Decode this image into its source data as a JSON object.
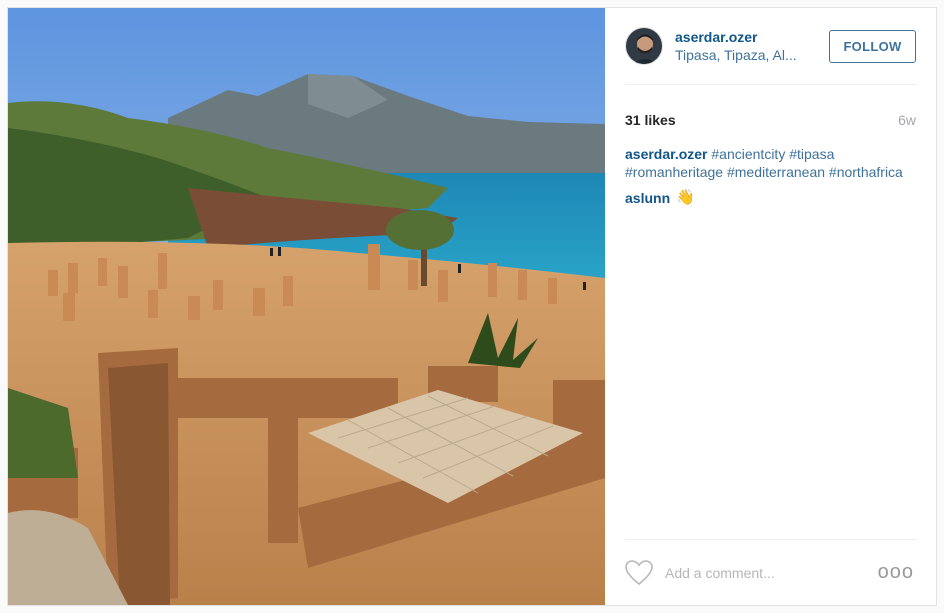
{
  "post": {
    "author": "aserdar.ozer",
    "location": "Tipasa, Tipaza, Al...",
    "follow_label": "FOLLOW",
    "likes": "31 likes",
    "age": "6w",
    "caption": {
      "user": "aserdar.ozer",
      "hashtags": [
        "#ancientcity",
        "#tipasa",
        "#romanheritage",
        "#mediterranean",
        "#northafrica"
      ]
    },
    "comments": [
      {
        "user": "aslunn",
        "emoji": "👋"
      }
    ],
    "comment_placeholder": "Add a comment...",
    "more_label": "ooo"
  },
  "icons": {
    "like": "heart-icon",
    "more": "more-options-icon",
    "wave": "waving-hand-emoji"
  },
  "colors": {
    "username": "#125688",
    "link": "#3f729b",
    "muted": "#a5a7aa"
  }
}
